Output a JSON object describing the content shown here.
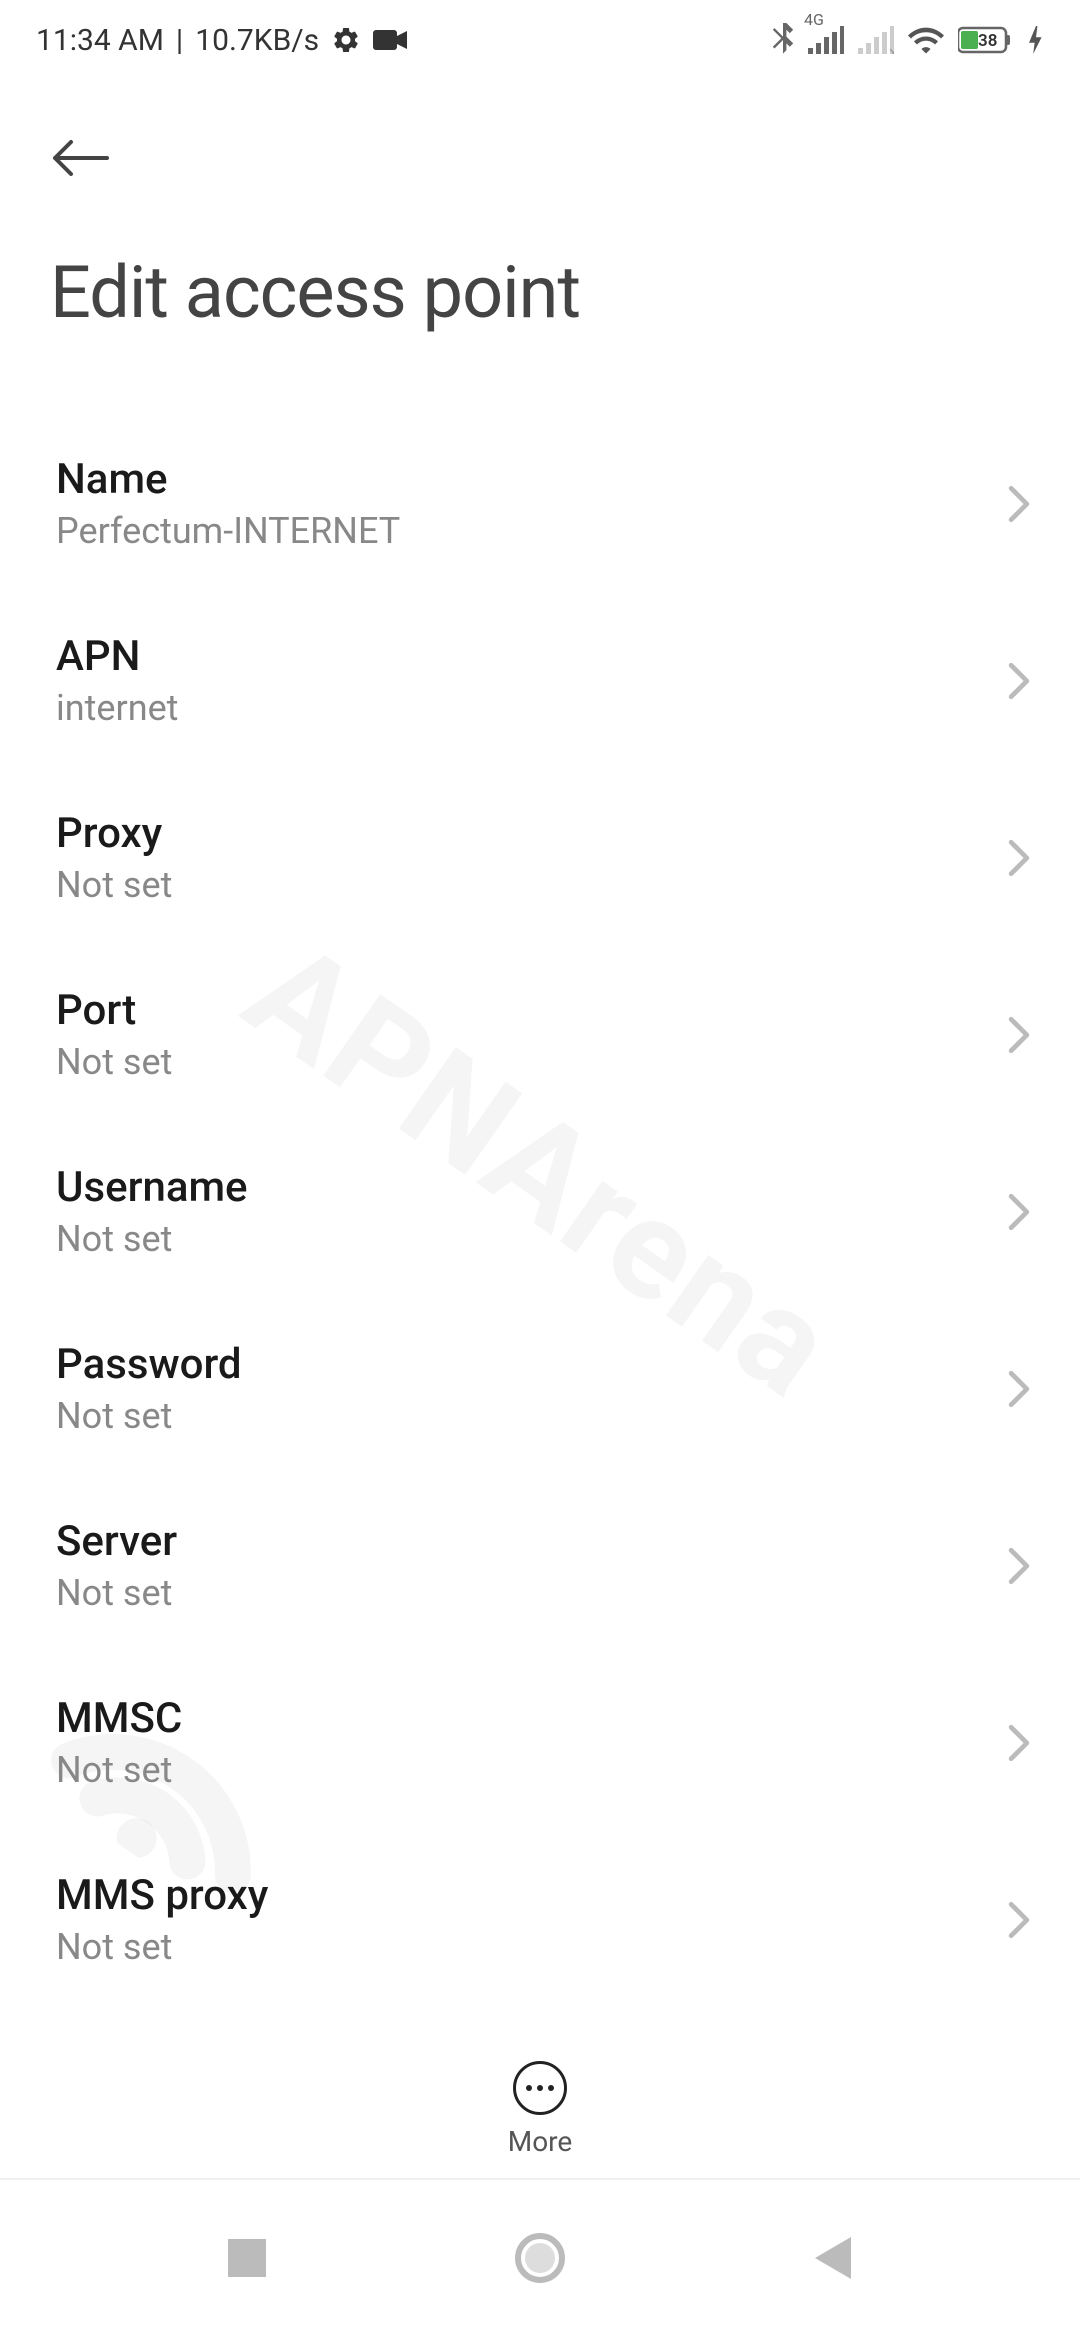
{
  "status_bar": {
    "time": "11:34 AM",
    "data_rate": "10.7KB/s",
    "network_label": "4G",
    "battery_percent": "38"
  },
  "header": {
    "title": "Edit access point"
  },
  "settings": [
    {
      "label": "Name",
      "value": "Perfectum-INTERNET"
    },
    {
      "label": "APN",
      "value": "internet"
    },
    {
      "label": "Proxy",
      "value": "Not set"
    },
    {
      "label": "Port",
      "value": "Not set"
    },
    {
      "label": "Username",
      "value": "Not set"
    },
    {
      "label": "Password",
      "value": "Not set"
    },
    {
      "label": "Server",
      "value": "Not set"
    },
    {
      "label": "MMSC",
      "value": "Not set"
    },
    {
      "label": "MMS proxy",
      "value": "Not set"
    }
  ],
  "more_button": {
    "label": "More"
  },
  "watermark": {
    "text": "APNArena"
  }
}
